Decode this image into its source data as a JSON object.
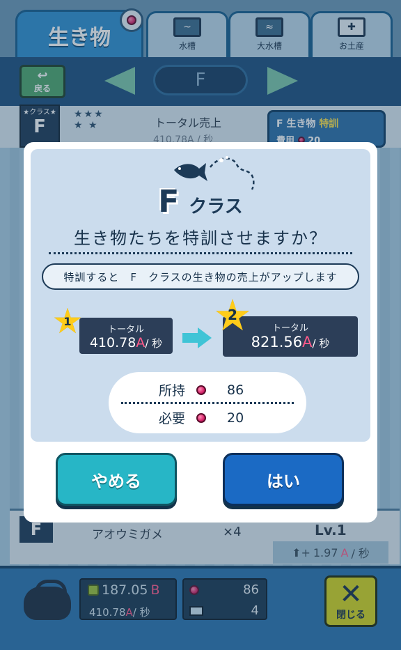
{
  "tabs": {
    "main_label": "生き物",
    "tank_label": "水槽",
    "big_tank_label": "大水槽",
    "souvenir_label": "お土産"
  },
  "nav": {
    "back_label": "戻る",
    "current_class": "F"
  },
  "background": {
    "class_caption": "★クラス★",
    "class_letter": "F",
    "total_label": "トータル売上",
    "total_value": "410.78A / 秒",
    "class_box_title": "F  生き物",
    "class_box_highlight": "特訓",
    "class_box_cost_label": "費用",
    "class_box_cost_value": "20",
    "row_class": "F",
    "row_name": "アオウミガメ",
    "row_multiplier": "×4",
    "row_level": "Lv.1",
    "row_rate_number": "1.97",
    "row_rate_accent": "A",
    "row_rate_unit": "/ 秒"
  },
  "modal": {
    "grade_letter": "F",
    "grade_word": "クラス",
    "question": "生き物たちを特訓させますか？",
    "description": "特訓すると　F　クラスの生き物の売上がアップします",
    "current": {
      "star_number": "1",
      "label": "トータル",
      "value": "410.78",
      "accent": "A",
      "unit": "/ 秒"
    },
    "next": {
      "star_number": "2",
      "label": "トータル",
      "value": "821.56",
      "accent": "A",
      "unit": "/ 秒"
    },
    "owned_label": "所持",
    "owned_value": "86",
    "required_label": "必要",
    "required_value": "20",
    "cancel_label": "やめる",
    "ok_label": "はい"
  },
  "bottom": {
    "coins_number": "187.05",
    "coins_accent": "B",
    "rate_number": "410.78",
    "rate_accent": "A",
    "rate_unit": "/ 秒",
    "gems": "86",
    "tickets": "4",
    "close_label": "閉じる"
  },
  "colors": {
    "accent_pink": "#ff5a8a",
    "cancel_button": "#27b6c6",
    "ok_button": "#1b6ac4",
    "star_yellow": "#ffcc1a"
  }
}
